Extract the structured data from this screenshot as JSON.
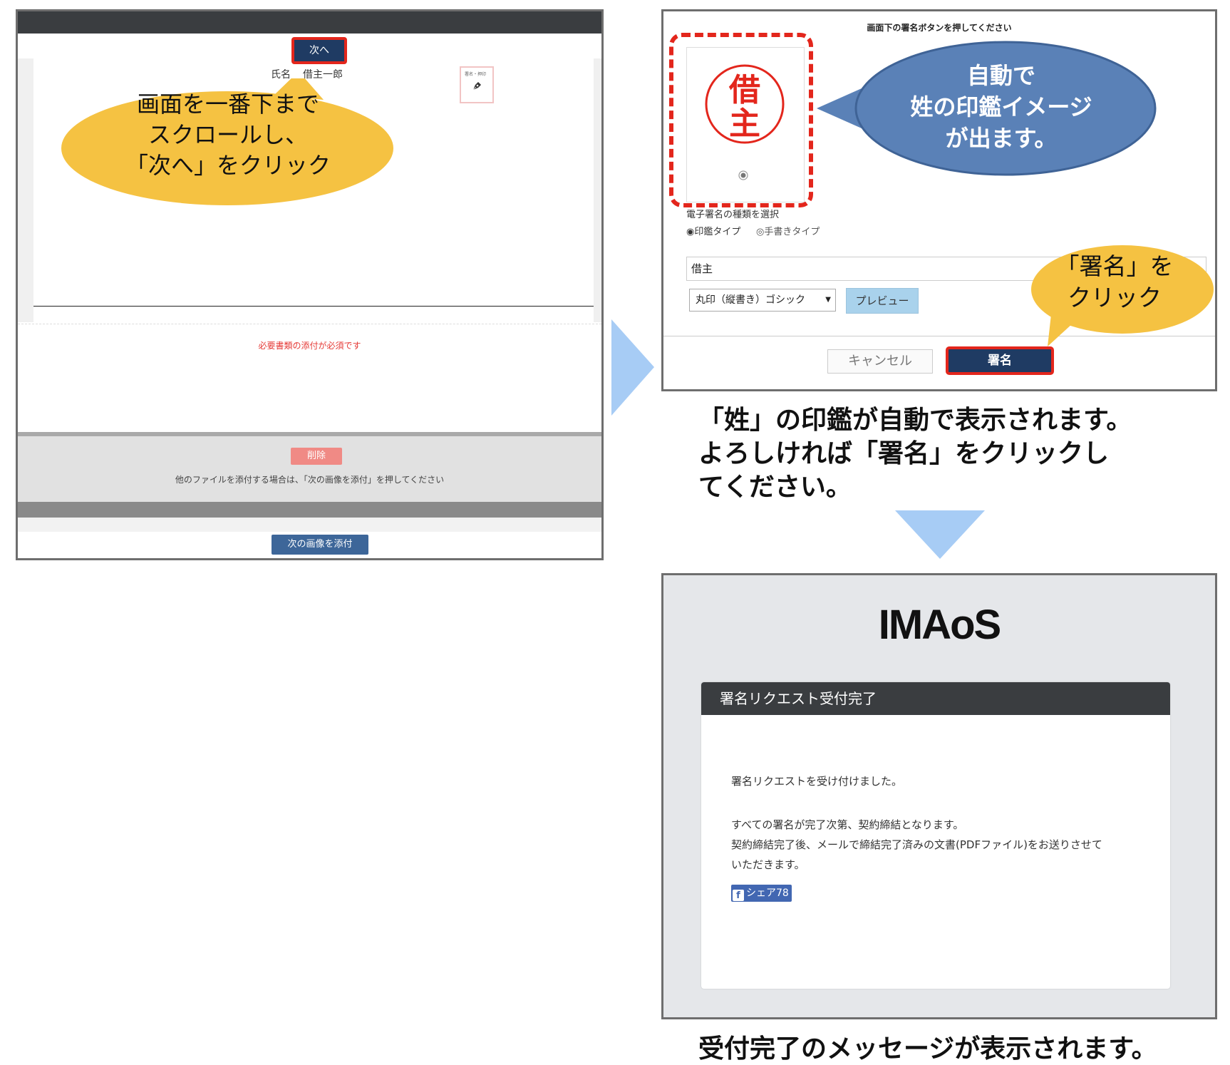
{
  "panel1": {
    "next_button": "次へ",
    "name_prefix": "氏名",
    "name_value": "借主一郎",
    "sigbox_label": "署名・押印",
    "warning": "必要書類の添付が必須です",
    "delete_button": "削除",
    "attach_hint": "他のファイルを添付する場合は、「次の画像を添付」を押してください",
    "attach_button": "次の画像を添付",
    "callout": [
      "画面を一番下まで",
      "スクロールし、",
      "「次へ」をクリック"
    ]
  },
  "panel2": {
    "title": "画面下の署名ボタンを押してください",
    "stamp_chars": [
      "借",
      "主"
    ],
    "sig_type_label": "電子署名の種類を選択",
    "option_stamp": "◉印鑑タイプ",
    "option_handwritten": "◎手書きタイプ",
    "name_input_value": "借主",
    "font_select_value": "丸印（縦書き）ゴシック",
    "preview_button": "プレビュー",
    "cancel_button": "キャンセル",
    "sign_button": "署名",
    "callout_auto": [
      "自動で",
      "姓の印鑑イメージ",
      "が出ます。"
    ],
    "callout_sign": [
      "「署名」を",
      "クリック"
    ]
  },
  "caption1": [
    "「姓」の印鑑が自動で表示されます。",
    "よろしければ「署名」をクリックし",
    "てください。"
  ],
  "panel3": {
    "logo": "IMAoS",
    "card_title": "署名リクエスト受付完了",
    "message_received": "署名リクエストを受け付けました。",
    "message_lines": [
      "すべての署名が完了次第、契約締結となります。",
      "契約締結完了後、メールで締結完了済みの文書(PDFファイル)をお送りさせて",
      "いただきます。"
    ],
    "share_icon": "f",
    "share_label": "シェア",
    "share_count": "78"
  },
  "caption2": "受付完了のメッセージが表示されます。",
  "colors": {
    "callout_yellow": "#f5c242",
    "callout_blue": "#5a81b7",
    "highlight_red": "#e3261c",
    "navy_button": "#1f3b63",
    "arrow_blue": "#a7ccf5"
  }
}
